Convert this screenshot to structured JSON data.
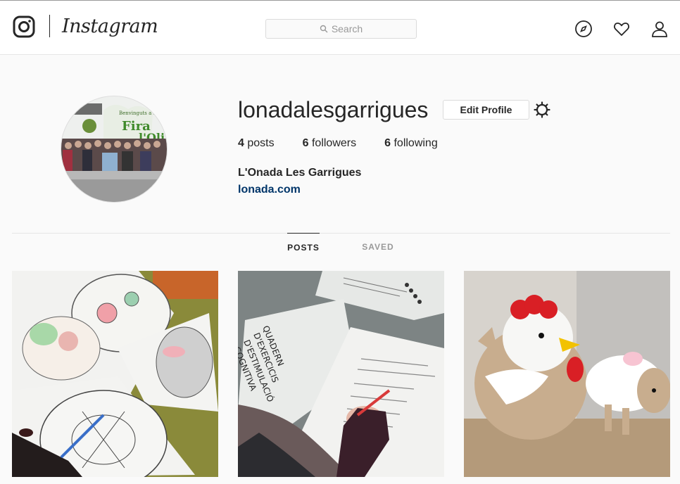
{
  "header": {
    "wordmark": "Instagram",
    "search_placeholder": "Search",
    "icons": [
      "instagram-glyph-icon",
      "search-icon",
      "compass-icon",
      "heart-icon",
      "person-icon"
    ]
  },
  "profile": {
    "username": "lonadalesgarrigues",
    "edit_profile_label": "Edit Profile",
    "stats": [
      {
        "count": "4",
        "label": "posts"
      },
      {
        "count": "6",
        "label": "followers"
      },
      {
        "count": "6",
        "label": "following"
      }
    ],
    "full_name": "L'Onada Les Garrigues",
    "website": "lonada.com",
    "avatar_banner_text": "Benvinguts a la Fira de l'Oli"
  },
  "tabs": [
    {
      "label": "POSTS",
      "active": true
    },
    {
      "label": "SAVED",
      "active": false
    }
  ],
  "posts": [
    {
      "description_icon": "coloring-pages-photo"
    },
    {
      "description_icon": "notebook-photo",
      "notebook_title_lines": [
        "QUADERN",
        "D'EXERCICIS",
        "D'ESTIMULACIÓ",
        "COGNITIVA"
      ]
    },
    {
      "description_icon": "crochet-hen-photo"
    }
  ],
  "colors": {
    "link": "#003569",
    "text": "#262626",
    "muted": "#999999",
    "border": "#dbdbdb",
    "background": "#fafafa"
  }
}
